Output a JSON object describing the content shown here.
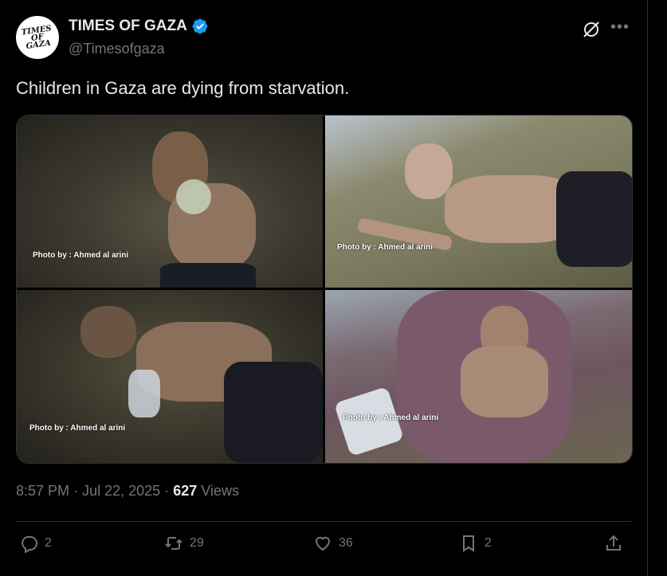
{
  "account": {
    "display_name": "TIMES OF GAZA",
    "handle": "@Timesofgaza",
    "avatar_logo": "TIMES OF GAZA",
    "verified_color": "#1d9bf0"
  },
  "tweet": {
    "text": "Children in Gaza are dying from starvation."
  },
  "media": {
    "photos": [
      {
        "credit": "Photo by : Ahmed al arini"
      },
      {
        "credit": "Photo by : Ahmed al arini"
      },
      {
        "credit": "Photo by : Ahmed al arini"
      },
      {
        "credit": "Photo by : Ahmed al arini"
      }
    ]
  },
  "meta": {
    "time": "8:57 PM",
    "date": "Jul 22, 2025",
    "separator": "·",
    "views_count": "627",
    "views_label": "Views"
  },
  "actions": {
    "replies": "2",
    "reposts": "29",
    "likes": "36",
    "bookmarks": "2"
  },
  "icons": [
    "grok-icon",
    "more-icon",
    "verified-badge-icon",
    "reply-icon",
    "repost-icon",
    "like-icon",
    "bookmark-icon",
    "share-icon"
  ],
  "colors": {
    "background": "#000000",
    "text": "#e7e9ea",
    "muted": "#71767b",
    "border": "#2f3336"
  }
}
